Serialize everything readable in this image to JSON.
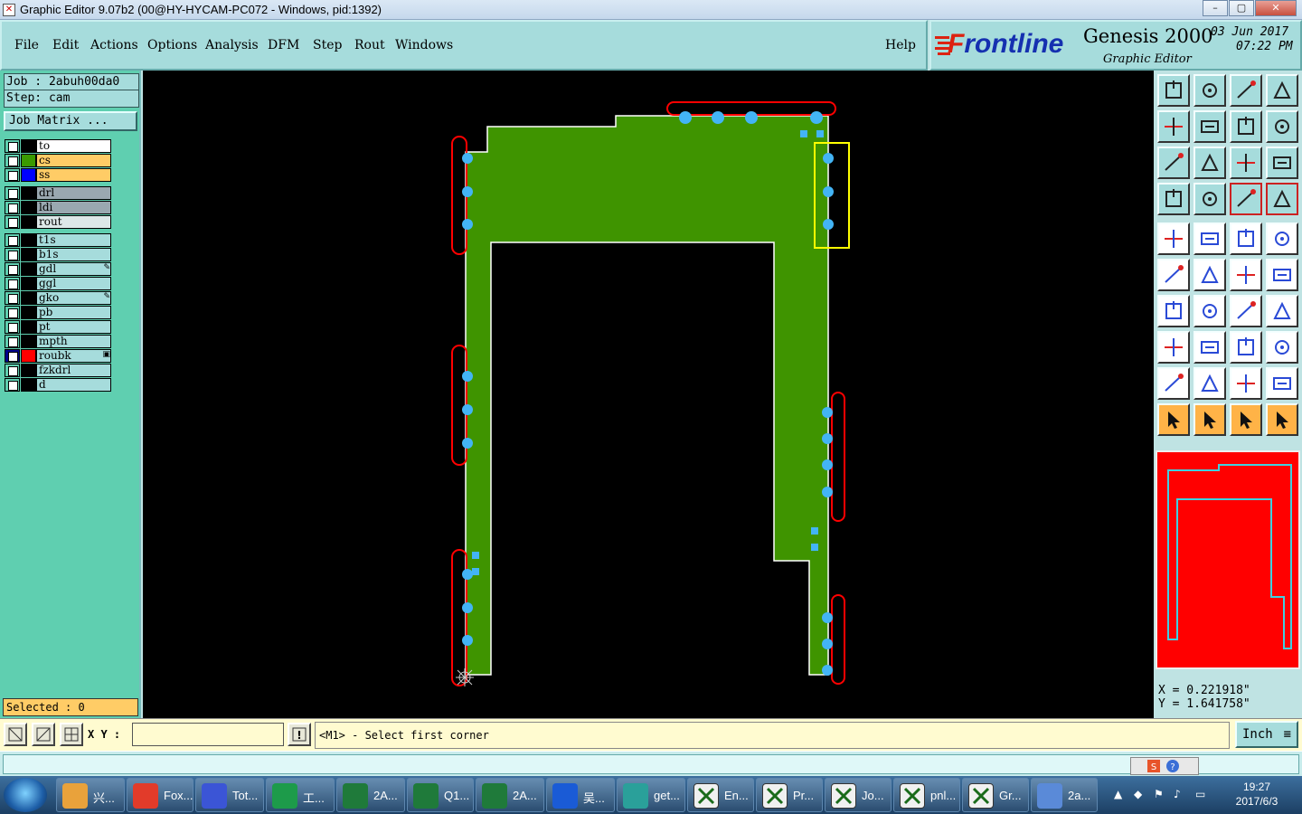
{
  "window": {
    "title": "Graphic Editor 9.07b2 (00@HY-HYCAM-PC072 - Windows, pid:1392)",
    "controls": [
      "–",
      "▢",
      "✕"
    ]
  },
  "menu": {
    "items": [
      "File",
      "Edit",
      "Actions",
      "Options",
      "Analysis",
      "DFM",
      "Step",
      "Rout",
      "Windows"
    ],
    "help": "Help"
  },
  "brand": {
    "logo_prefix": "F",
    "logo_rest": "rontline",
    "product": "Genesis 2000",
    "subtitle": "Graphic Editor",
    "date": "03 Jun 2017",
    "time": "07:22 PM"
  },
  "job": {
    "job_label": "Job : 2abuh00da0",
    "step_label": "Step: cam",
    "matrix_button": "Job Matrix ..."
  },
  "layers": [
    {
      "name": "to",
      "swatch": "#000000",
      "bg": "#ffffff",
      "mark": ""
    },
    {
      "name": "cs",
      "swatch": "#3a9a00",
      "bg": "#ffcc66",
      "mark": ""
    },
    {
      "name": "ss",
      "swatch": "#0000ff",
      "bg": "#ffcc66",
      "mark": ""
    },
    {
      "name": "drl",
      "swatch": "#000000",
      "bg": "#9aa8b0",
      "mark": ""
    },
    {
      "name": "ldi",
      "swatch": "#000000",
      "bg": "#9aa8b0",
      "mark": ""
    },
    {
      "name": "rout",
      "swatch": "#000000",
      "bg": "#dde8e8",
      "mark": ""
    },
    {
      "name": "t1s",
      "swatch": "#000000",
      "bg": "#a6dcdc",
      "mark": ""
    },
    {
      "name": "b1s",
      "swatch": "#000000",
      "bg": "#a6dcdc",
      "mark": ""
    },
    {
      "name": "gdl",
      "swatch": "#000000",
      "bg": "#a6dcdc",
      "mark": "✎"
    },
    {
      "name": "ggl",
      "swatch": "#000000",
      "bg": "#a6dcdc",
      "mark": ""
    },
    {
      "name": "gko",
      "swatch": "#000000",
      "bg": "#a6dcdc",
      "mark": "✎"
    },
    {
      "name": "pb",
      "swatch": "#000000",
      "bg": "#a6dcdc",
      "mark": ""
    },
    {
      "name": "pt",
      "swatch": "#000000",
      "bg": "#a6dcdc",
      "mark": ""
    },
    {
      "name": "mpth",
      "swatch": "#000000",
      "bg": "#a6dcdc",
      "mark": ""
    },
    {
      "name": "roubk",
      "swatch": "#ff0000",
      "bg": "#a6dcdc",
      "mark": "▣",
      "active": true
    },
    {
      "name": "fzkdrl",
      "swatch": "#000000",
      "bg": "#a6dcdc",
      "mark": ""
    },
    {
      "name": "d",
      "swatch": "#000000",
      "bg": "#a6dcdc",
      "mark": ""
    }
  ],
  "selection": {
    "label": "Selected : 0"
  },
  "coords": {
    "x": "X = 0.221918\"",
    "y": "Y = 1.641758\""
  },
  "command": {
    "xy_label": "X Y :",
    "xy_value": "",
    "prompt": "<M1> - Select first corner",
    "unit": "Inch"
  },
  "colors": {
    "board": "#3f9400",
    "pads": "#43b4f5",
    "rout_marks": "#ff0000",
    "highlight": "#ffff00",
    "canvas_bg": "#000000"
  },
  "taskbar": {
    "items": [
      {
        "label": "兴...",
        "icon": "shell-icon",
        "color": "#e9a23b"
      },
      {
        "label": "Fox...",
        "icon": "foxit-icon",
        "color": "#e23b2a"
      },
      {
        "label": "Tot...",
        "icon": "floppy-icon",
        "color": "#3b55d6"
      },
      {
        "label": "工...",
        "icon": "p-app-icon",
        "color": "#1d9b4a"
      },
      {
        "label": "2A...",
        "icon": "excel-icon",
        "color": "#1f7a3a"
      },
      {
        "label": "Q1...",
        "icon": "excel-icon",
        "color": "#1f7a3a"
      },
      {
        "label": "2A...",
        "icon": "excel-icon",
        "color": "#1f7a3a"
      },
      {
        "label": "吴...",
        "icon": "frontline-icon",
        "color": "#1a5bd6"
      },
      {
        "label": "get...",
        "icon": "eye-icon",
        "color": "#2aa09a"
      },
      {
        "label": "En...",
        "icon": "genesis-icon",
        "color": "#f0f0f0"
      },
      {
        "label": "Pr...",
        "icon": "genesis-icon",
        "color": "#f0f0f0"
      },
      {
        "label": "Jo...",
        "icon": "genesis-icon",
        "color": "#f0f0f0"
      },
      {
        "label": "pnl...",
        "icon": "genesis-icon",
        "color": "#f0f0f0"
      },
      {
        "label": "Gr...",
        "icon": "genesis-icon",
        "color": "#f0f0f0"
      },
      {
        "label": "2a...",
        "icon": "wordpad-icon",
        "color": "#5a8ad8"
      }
    ],
    "clock_time": "19:27",
    "clock_date": "2017/6/3"
  }
}
